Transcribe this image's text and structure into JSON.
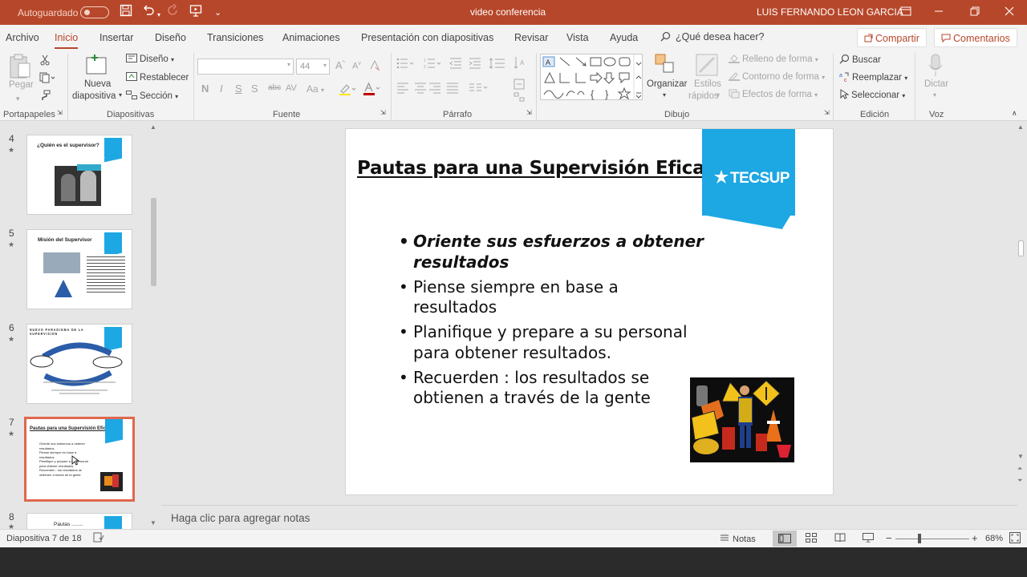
{
  "colors": {
    "accent": "#b7472a",
    "brand_blue": "#1da7e3",
    "selected_slide_border": "#e0674d"
  },
  "titlebar": {
    "autosave_label": "Autoguardado",
    "doc_title": "video conferencia",
    "user_name": "LUIS FERNANDO LEON GARCIA",
    "icons": [
      "save-icon",
      "undo-icon",
      "redo-icon",
      "start-presentation-icon",
      "customize-icon"
    ]
  },
  "menu": {
    "tabs": [
      "Archivo",
      "Inicio",
      "Insertar",
      "Diseño",
      "Transiciones",
      "Animaciones",
      "Presentación con diapositivas",
      "Revisar",
      "Vista",
      "Ayuda"
    ],
    "active_tab": "Inicio",
    "search_placeholder": "¿Qué desea hacer?",
    "share_label": "Compartir",
    "comments_label": "Comentarios"
  },
  "ribbon": {
    "clipboard": {
      "paste": "Pegar",
      "label": "Portapapeles"
    },
    "slides": {
      "new_slide_1": "Nueva",
      "new_slide_2": "diapositiva",
      "design": "Diseño",
      "reset": "Restablecer",
      "section": "Sección",
      "label": "Diapositivas"
    },
    "font": {
      "size": "44",
      "bold": "N",
      "italic": "I",
      "underline": "S",
      "strike": "S",
      "spacing": "AV",
      "case": "Aa",
      "label": "Fuente"
    },
    "paragraph": {
      "label": "Párrafo"
    },
    "drawing": {
      "arrange": "Organizar",
      "quick_styles_1": "Estilos",
      "quick_styles_2": "rápidos",
      "fill": "Relleno de forma",
      "outline": "Contorno de forma",
      "effects": "Efectos de forma",
      "label": "Dibujo"
    },
    "editing": {
      "find": "Buscar",
      "replace": "Reemplazar",
      "select": "Seleccionar",
      "label": "Edición"
    },
    "voice": {
      "dictate": "Dictar",
      "label": "Voz"
    }
  },
  "thumbnails": [
    {
      "num": "4",
      "title": "¿Quién es el supervisor?"
    },
    {
      "num": "5",
      "title": "Misión del Supervisor"
    },
    {
      "num": "6",
      "title": "NUEVO PARADIGMA DE LA SUPERVISION"
    },
    {
      "num": "7",
      "title": "Pautas para una Supervisión Eficaz",
      "selected": true
    },
    {
      "num": "8",
      "title": "Pautas ........"
    }
  ],
  "slide": {
    "title": "Pautas para una Supervisión Eficaz",
    "logo_text": "TECSUP",
    "bullets": [
      {
        "line1": "Oriente sus esfuerzos a obtener",
        "line2": "resultados"
      },
      {
        "line1": "Piense siempre en base a",
        "line2": "resultados"
      },
      {
        "line1": "Planifique y prepare a su personal",
        "line2": "para obtener resultados."
      },
      {
        "line1": "Recuerden : los resultados se",
        "line2": "obtienen a través de la gente"
      }
    ]
  },
  "notes_placeholder": "Haga clic para agregar notas",
  "status": {
    "slide_counter": "Diapositiva 7 de 18",
    "notes_label": "Notas",
    "zoom": "68%",
    "zoom_fraction": 0.68
  }
}
